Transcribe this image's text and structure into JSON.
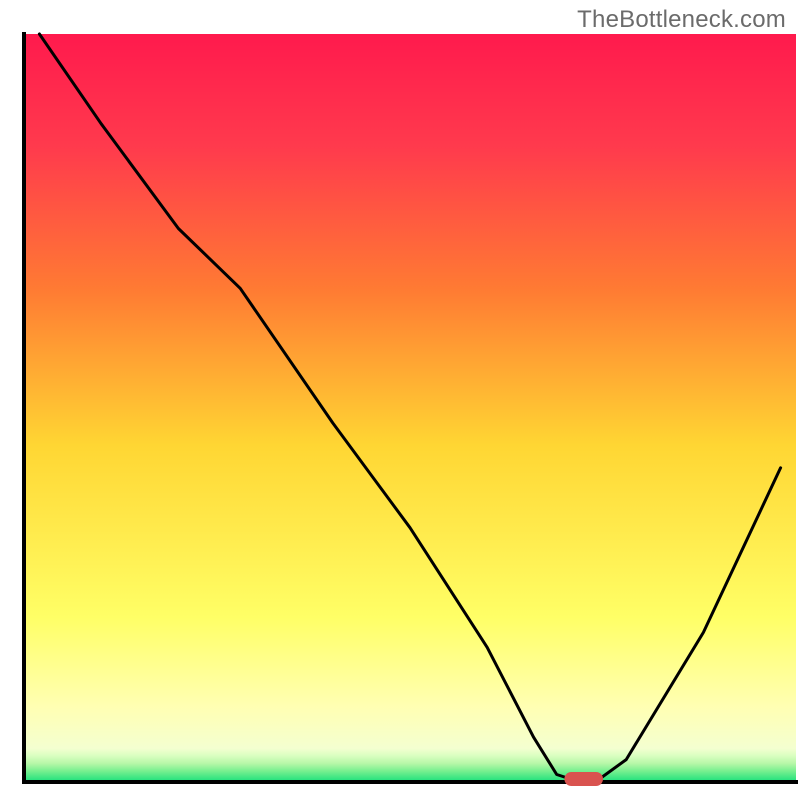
{
  "watermark": "TheBottleneck.com",
  "chart_data": {
    "type": "line",
    "title": "",
    "xlabel": "",
    "ylabel": "",
    "xlim": [
      0,
      100
    ],
    "ylim": [
      0,
      100
    ],
    "background_gradient": {
      "top": "#ff1a4d",
      "mid1": "#ff7a33",
      "mid2": "#ffd633",
      "mid3": "#ffff66",
      "mid4": "#ffffb3",
      "bottom": "#19e07b"
    },
    "axes": {
      "show_ticks": false,
      "show_grid": false,
      "axis_color": "#000000"
    },
    "series": [
      {
        "name": "bottleneck-curve",
        "color": "#000000",
        "x": [
          2,
          10,
          20,
          28,
          40,
          50,
          60,
          66,
          69,
          72,
          74,
          78,
          88,
          98
        ],
        "y": [
          100,
          88,
          74,
          66,
          48,
          34,
          18,
          6,
          1,
          0,
          0,
          3,
          20,
          42
        ]
      }
    ],
    "marker": {
      "name": "optimal-range-marker",
      "x_start": 70,
      "x_end": 75,
      "y": 0,
      "color": "#d9534f"
    }
  }
}
